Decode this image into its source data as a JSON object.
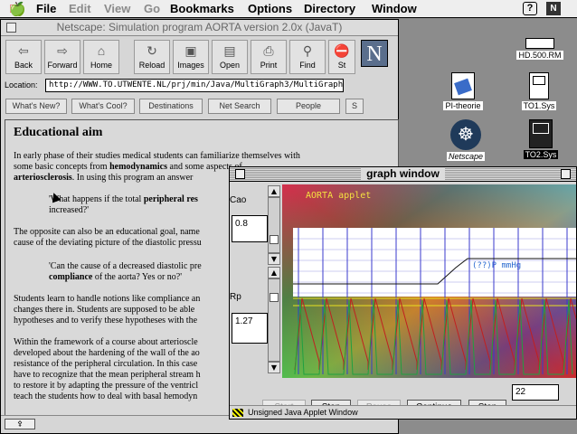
{
  "menubar": {
    "items": [
      "File",
      "Edit",
      "View",
      "Go",
      "Bookmarks",
      "Options",
      "Directory",
      "Window"
    ],
    "disabled": [
      false,
      true,
      true,
      true,
      false,
      false,
      false,
      false
    ]
  },
  "desktop": {
    "icons": [
      {
        "label": "HD.500.RM"
      },
      {
        "label": "PI-theorie"
      },
      {
        "label": "TO1.Sys"
      },
      {
        "label": "Netscape"
      },
      {
        "label": "TO2.Sys"
      }
    ]
  },
  "browser": {
    "title": "Netscape: Simulation program AORTA version 2.0x (JavaT)",
    "toolbar": [
      "Back",
      "Forward",
      "Home",
      "Reload",
      "Images",
      "Open",
      "Print",
      "Find",
      "St"
    ],
    "location_label": "Location:",
    "location_value": "http://WWW.TO.UTWENTE.NL/prj/min/Java/MultiGraph3/MultiGraph1",
    "directory_buttons": [
      "What's New?",
      "What's Cool?",
      "Destinations",
      "Net Search",
      "People",
      "S"
    ],
    "logo": "N",
    "content": {
      "heading": "Educational aim",
      "p1a": "In early phase of their studies medical students can familiarize themselves with",
      "p1b": "some basic concepts from",
      "p1b_bold": "hemodynamics",
      "p1b_rest": "and some aspects of",
      "p1c_bold": "arteriosclerosis",
      "p1c_rest": ". In using this program an answer",
      "q1a": "'What happens if the total",
      "q1a_bold": "peripheral res",
      "q1b": "increased?'",
      "p2a": "The opposite can also be an educational goal, name",
      "p2b": "cause of the deviating picture of the diastolic pressu",
      "q2a": "'Can the cause of a decreased diastolic pre",
      "q2b_bold": "compliance",
      "q2b_rest": "of the aorta? Yes or no?'",
      "p3a": "Students learn to handle notions like compliance an",
      "p3b": "changes there in. Students are supposed to be able",
      "p3c": "hypotheses and to verify these hypotheses with the",
      "p4a": "Within the framework of a course about arterioscle",
      "p4b": "developed about the hardening of the wall of the ao",
      "p4c": "resistance of the peripheral circulation. In this case",
      "p4d": "have to recognize that the mean peripheral stream h",
      "p4e": "to restore it by adapting the pressure of the ventricl",
      "p4f": "teach the students how to deal with basal hemodyn"
    }
  },
  "graph_window": {
    "title": "graph window",
    "param1_label": "Cao",
    "param1_value": "0.8",
    "param2_label": "Rp",
    "param2_value": "1.27",
    "applet_label": "AORTA applet",
    "curve_label": "(??)P mmHg",
    "buttons": [
      "Start",
      "Stop",
      "Pause",
      "Continue",
      "Step"
    ],
    "buttons_disabled": [
      true,
      false,
      true,
      false,
      false
    ],
    "step_value": "22",
    "status": "Unsigned Java Applet Window"
  },
  "colors": {
    "plot_bg": "#ffffff",
    "grid": "#3a3acc",
    "art_red": "#c02020",
    "art_yellow": "#e8e020"
  }
}
